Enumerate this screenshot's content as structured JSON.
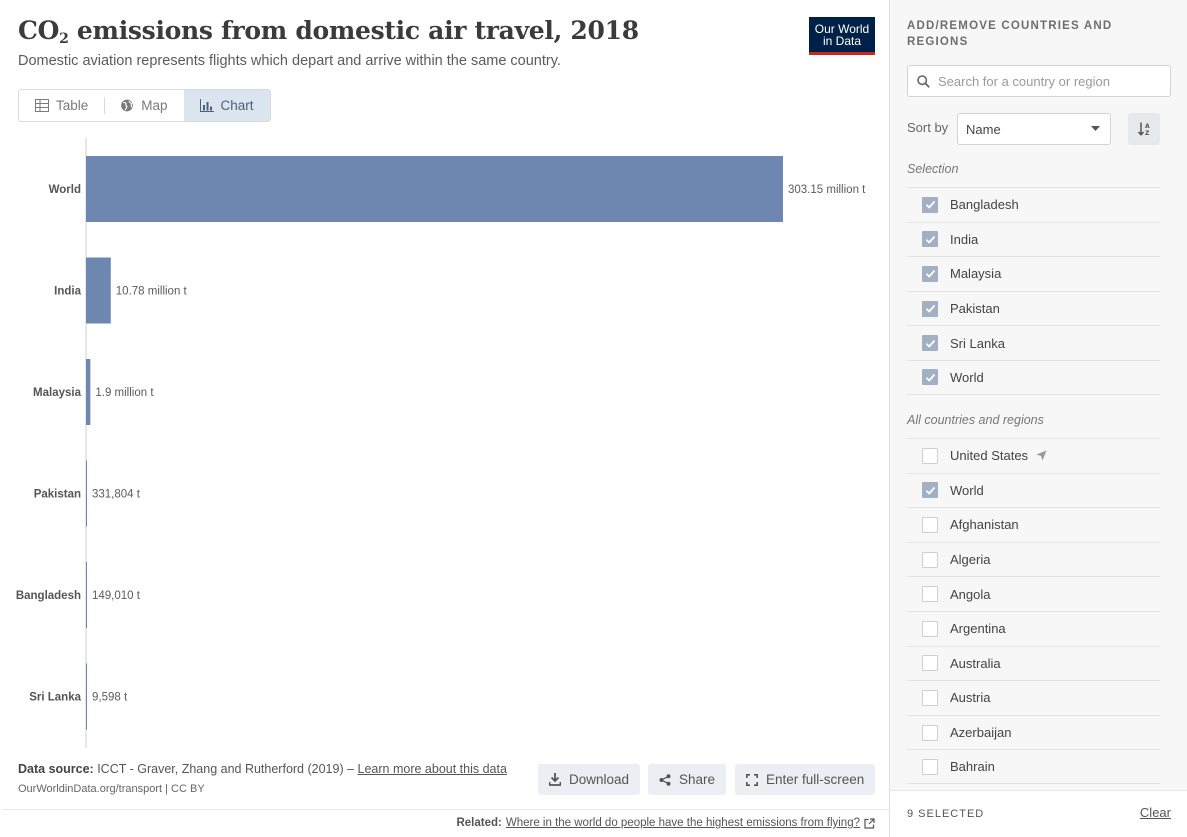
{
  "header": {
    "title_main": "CO",
    "title_sub": "2",
    "title_rest": " emissions from domestic air travel, 2018",
    "subtitle": "Domestic aviation represents flights which depart and arrive within the same country.",
    "logo_line1": "Our World",
    "logo_line2": "in Data"
  },
  "tabs": [
    {
      "label": "Table",
      "icon": "table-icon",
      "active": false
    },
    {
      "label": "Map",
      "icon": "globe-icon",
      "active": false
    },
    {
      "label": "Chart",
      "icon": "chart-icon",
      "active": true
    }
  ],
  "chart_data": {
    "type": "bar",
    "orientation": "horizontal",
    "bar_color": "#6d87b0",
    "categories": [
      "World",
      "India",
      "Malaysia",
      "Pakistan",
      "Bangladesh",
      "Sri Lanka"
    ],
    "values": [
      303150000,
      10780000,
      1900000,
      331804,
      149010,
      9598
    ],
    "value_labels": [
      "303.15 million t",
      "10.78 million t",
      "1.9 million t",
      "331,804 t",
      "149,010 t",
      "9,598 t"
    ]
  },
  "footer": {
    "source_label": "Data source:",
    "source_text": " ICCT - Graver, Zhang and Rutherford (2019) – ",
    "learn_more": "Learn more about this data",
    "license": "OurWorldinData.org/transport | CC BY",
    "download_label": "Download",
    "share_label": "Share",
    "fullscreen_label": "Enter full-screen",
    "related_label": "Related:",
    "related_link": "Where in the world do people have the highest emissions from flying?"
  },
  "side_panel": {
    "heading": "ADD/REMOVE COUNTRIES AND REGIONS",
    "search_placeholder": "Search for a country or region",
    "sort_label": "Sort by",
    "sort_value": "Name",
    "selection_label": "Selection",
    "all_label": "All countries and regions",
    "selected": [
      {
        "name": "Bangladesh",
        "checked": true
      },
      {
        "name": "India",
        "checked": true
      },
      {
        "name": "Malaysia",
        "checked": true
      },
      {
        "name": "Pakistan",
        "checked": true
      },
      {
        "name": "Sri Lanka",
        "checked": true
      },
      {
        "name": "World",
        "checked": true
      }
    ],
    "all": [
      {
        "name": "United States",
        "checked": false,
        "local": true
      },
      {
        "name": "World",
        "checked": true
      },
      {
        "name": "Afghanistan",
        "checked": false
      },
      {
        "name": "Algeria",
        "checked": false
      },
      {
        "name": "Angola",
        "checked": false
      },
      {
        "name": "Argentina",
        "checked": false
      },
      {
        "name": "Australia",
        "checked": false
      },
      {
        "name": "Austria",
        "checked": false
      },
      {
        "name": "Azerbaijan",
        "checked": false
      },
      {
        "name": "Bahrain",
        "checked": false
      }
    ],
    "selected_count": "9 SELECTED",
    "clear_label": "Clear"
  }
}
